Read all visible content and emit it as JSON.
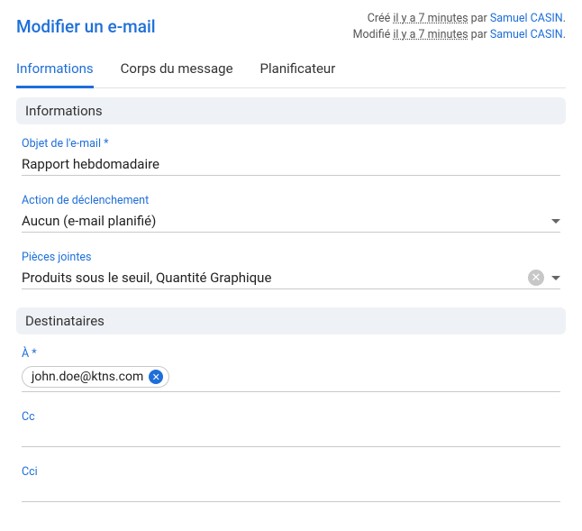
{
  "header": {
    "title": "Modifier un e-mail",
    "created_prefix": "Créé ",
    "created_time": "il y a 7 minutes",
    "created_by_word": "par ",
    "created_user": "Samuel CASIN",
    "modified_prefix": "Modifié ",
    "modified_time": "il y a 7 minutes",
    "modified_by_word": "par ",
    "modified_user": "Samuel CASIN",
    "period": "."
  },
  "tabs": {
    "info": "Informations",
    "body": "Corps du message",
    "sched": "Planificateur"
  },
  "section_info": "Informations",
  "fields": {
    "subject_label": "Objet de l'e-mail *",
    "subject_value": "Rapport hebdomadaire",
    "trigger_label": "Action de déclenchement",
    "trigger_value": "Aucun (e-mail planifié)",
    "attach_label": "Pièces jointes",
    "attach_value": "Produits sous le seuil, Quantité Graphique"
  },
  "section_recip": "Destinataires",
  "recip": {
    "to_label": "À *",
    "to_chip": "john.doe@ktns.com",
    "cc_label": "Cc",
    "bcc_label": "Cci"
  }
}
